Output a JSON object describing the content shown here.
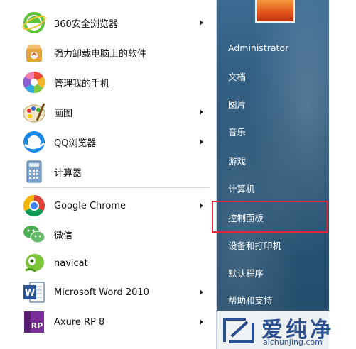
{
  "programs": [
    {
      "label": "360安全浏览器",
      "icon": "360-browser-icon",
      "has_submenu": true
    },
    {
      "label": "强力卸载电脑上的软件",
      "icon": "uninstaller-box-icon",
      "has_submenu": false
    },
    {
      "label": "管理我的手机",
      "icon": "phone-manager-icon",
      "has_submenu": false
    },
    {
      "label": "画图",
      "icon": "paint-palette-icon",
      "has_submenu": true
    },
    {
      "label": "QQ浏览器",
      "icon": "qq-browser-icon",
      "has_submenu": true
    },
    {
      "label": "计算器",
      "icon": "calculator-icon",
      "has_submenu": false
    },
    {
      "label": "Google Chrome",
      "icon": "chrome-icon",
      "has_submenu": true
    },
    {
      "label": "微信",
      "icon": "wechat-icon",
      "has_submenu": false
    },
    {
      "label": "navicat",
      "icon": "navicat-icon",
      "has_submenu": false
    },
    {
      "label": "Microsoft Word 2010",
      "icon": "word-icon",
      "has_submenu": true
    },
    {
      "label": "Axure RP 8",
      "icon": "axure-icon",
      "has_submenu": true
    }
  ],
  "right_menu": [
    {
      "label": "Administrator"
    },
    {
      "label": "文档"
    },
    {
      "label": "图片"
    },
    {
      "label": "音乐"
    },
    {
      "label": "游戏"
    },
    {
      "label": "计算机"
    },
    {
      "label": "控制面板",
      "highlighted": true
    },
    {
      "label": "设备和打印机"
    },
    {
      "label": "默认程序"
    },
    {
      "label": "帮助和支持"
    }
  ],
  "watermark": {
    "title": "爱纯净",
    "url": "aichunjing.com"
  },
  "colors": {
    "highlight_border": "#e3263a",
    "pane_blue": "#2b5678",
    "watermark_blue": "#2a4f8f"
  }
}
